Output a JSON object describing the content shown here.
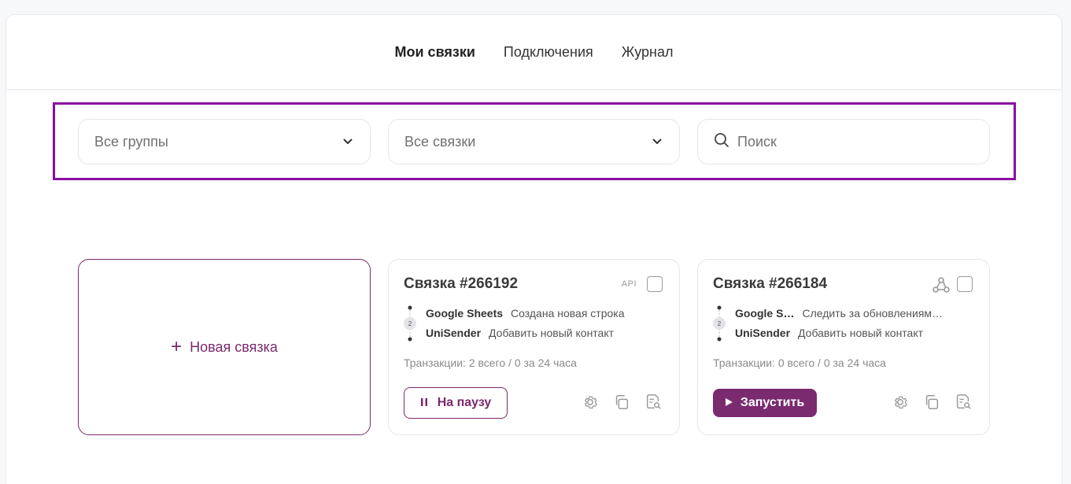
{
  "nav": {
    "tabs": [
      {
        "label": "Мои связки",
        "active": true
      },
      {
        "label": "Подключения",
        "active": false
      },
      {
        "label": "Журнал",
        "active": false
      }
    ]
  },
  "filters": {
    "groups": {
      "value": "Все группы"
    },
    "links": {
      "value": "Все связки"
    },
    "search": {
      "placeholder": "Поиск"
    }
  },
  "new_card": {
    "label": "Новая связка"
  },
  "cards": [
    {
      "title": "Связка #266192",
      "badge": "API",
      "step_count": "2",
      "steps": [
        {
          "app": "Google Sheets",
          "action": "Создана новая строка"
        },
        {
          "app": "UniSender",
          "action": "Добавить новый контакт"
        }
      ],
      "transactions": "Транзакции: 2 всего / 0 за 24 часа",
      "button": "На паузу"
    },
    {
      "title": "Связка #266184",
      "badge_icon": "webhook-icon",
      "step_count": "2",
      "steps": [
        {
          "app": "Google S…",
          "action": "Следить за обновлениям…"
        },
        {
          "app": "UniSender",
          "action": "Добавить новый контакт"
        }
      ],
      "transactions": "Транзакции: 0 всего / 0 за 24 часа",
      "button": "Запустить"
    }
  ],
  "colors": {
    "accent": "#7a2a6e",
    "highlight": "#8a0ca2",
    "border": "#e6e6ea"
  }
}
